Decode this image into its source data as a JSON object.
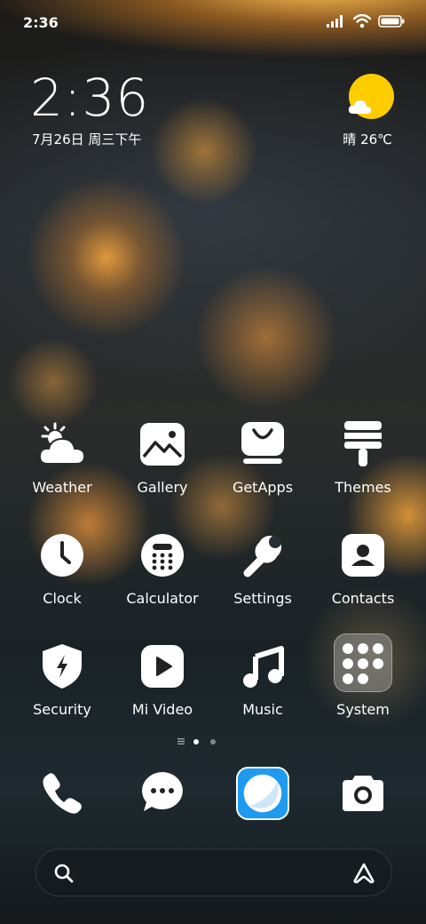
{
  "status_bar": {
    "time": "2:36"
  },
  "clock_widget": {
    "time": "2:36",
    "date": "7月26日 周三下午"
  },
  "weather_widget": {
    "text": "晴 26℃",
    "sun_color": "#ffcc00"
  },
  "apps": [
    {
      "label": "Weather",
      "icon": "weather-icon"
    },
    {
      "label": "Gallery",
      "icon": "gallery-icon"
    },
    {
      "label": "GetApps",
      "icon": "getapps-icon"
    },
    {
      "label": "Themes",
      "icon": "themes-icon"
    },
    {
      "label": "Clock",
      "icon": "clock-icon"
    },
    {
      "label": "Calculator",
      "icon": "calculator-icon"
    },
    {
      "label": "Settings",
      "icon": "settings-icon"
    },
    {
      "label": "Contacts",
      "icon": "contacts-icon"
    },
    {
      "label": "Security",
      "icon": "security-icon"
    },
    {
      "label": "Mi Video",
      "icon": "mivideo-icon"
    },
    {
      "label": "Music",
      "icon": "music-icon"
    },
    {
      "label": "System",
      "icon": "system-folder-icon"
    }
  ],
  "pager": {
    "pages": 2,
    "current": 1
  },
  "dock": [
    {
      "icon": "phone-icon"
    },
    {
      "icon": "messages-icon"
    },
    {
      "icon": "browser-icon",
      "color": "#1e9bf0"
    },
    {
      "icon": "camera-icon"
    }
  ],
  "search": {
    "placeholder": ""
  }
}
